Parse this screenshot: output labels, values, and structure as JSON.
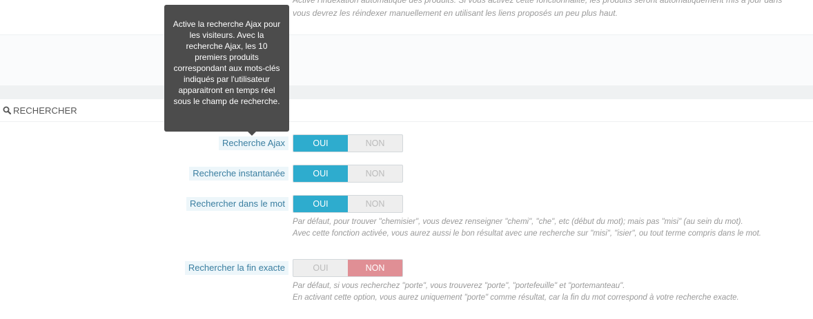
{
  "top_help": {
    "line1": "Active l'indexation automatique des produits. Si vous activez cette fonctionnalité, les produits seront automatiquement mis à jour dans",
    "line2": "vous devrez les réindexer manuellement en utilisant les liens proposés un peu plus haut."
  },
  "panel": {
    "title": "RECHERCHER",
    "icon": "search-icon"
  },
  "tooltip": {
    "text": "Active la recherche Ajax pour les visiteurs. Avec la recherche Ajax, les 10 premiers produits correspondant aux mots-clés indiqués par l'utilisateur apparaitront en temps réel sous le champ de recherche."
  },
  "options": [
    {
      "label": "Recherche Ajax",
      "yes_label": "OUI",
      "no_label": "NON",
      "value": "OUI"
    },
    {
      "label": "Recherche instantanée",
      "yes_label": "OUI",
      "no_label": "NON",
      "value": "OUI"
    },
    {
      "label": "Rechercher dans le mot",
      "yes_label": "OUI",
      "no_label": "NON",
      "value": "OUI",
      "help_line1": "Par défaut, pour trouver \"chemisier\", vous devez renseigner \"chemi\", \"che\", etc (début du mot); mais pas \"misi\" (au sein du mot).",
      "help_line2": "Avec cette fonction activée, vous aurez aussi le bon résultat avec une recherche sur \"misi\", \"isier\", ou tout terme compris dans le mot."
    },
    {
      "label": "Rechercher la fin exacte",
      "yes_label": "OUI",
      "no_label": "NON",
      "value": "NON",
      "help_line1": "Par défaut, si vous recherchez \"porte\", vous trouverez \"porte\", \"portefeuille\" et \"portemanteau\".",
      "help_line2": "En activant cette option, vous aurez uniquement \"porte\" comme résultat, car la fin du mot correspond à votre recherche exacte."
    }
  ],
  "colors": {
    "switch_on": "#2eacce",
    "switch_off_active": "#e08f95",
    "label_text": "#3a7ea0",
    "tooltip_bg": "#4c4c4c"
  }
}
